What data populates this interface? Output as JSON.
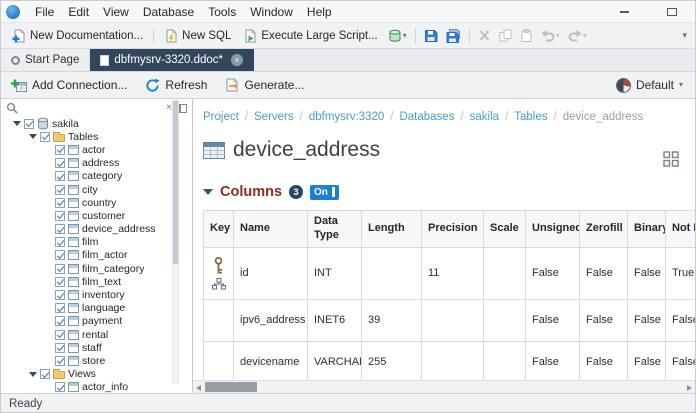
{
  "colors": {
    "accent_blue": "#1b7fd4",
    "link_blue": "#4a9bd5",
    "false_red": "#c13b2a",
    "true_green": "#23984e",
    "section_maroon": "#8e2a1f",
    "active_tab": "#33475c"
  },
  "menu_bar": {
    "items": [
      "File",
      "Edit",
      "View",
      "Database",
      "Tools",
      "Window",
      "Help"
    ]
  },
  "toolbar": {
    "new_documentation": "New Documentation...",
    "new_sql": "New SQL",
    "execute_large_script": "Execute Large Script..."
  },
  "tabs": {
    "start_page": "Start Page",
    "document": "dbfmysrv-3320.ddoc*"
  },
  "doc_toolbar": {
    "add_connection": "Add Connection...",
    "refresh": "Refresh",
    "generate": "Generate...",
    "skin": "Default"
  },
  "tree": {
    "items": [
      {
        "label": "sakila"
      },
      {
        "label": "Tables"
      },
      {
        "label": "actor"
      },
      {
        "label": "address"
      },
      {
        "label": "category"
      },
      {
        "label": "city"
      },
      {
        "label": "country"
      },
      {
        "label": "customer"
      },
      {
        "label": "device_address"
      },
      {
        "label": "film"
      },
      {
        "label": "film_actor"
      },
      {
        "label": "film_category"
      },
      {
        "label": "film_text"
      },
      {
        "label": "inventory"
      },
      {
        "label": "language"
      },
      {
        "label": "payment"
      },
      {
        "label": "rental"
      },
      {
        "label": "staff"
      },
      {
        "label": "store"
      },
      {
        "label": "Views"
      },
      {
        "label": "actor_info"
      }
    ]
  },
  "content": {
    "breadcrumb": {
      "separator": "/",
      "items": [
        "Project",
        "Servers",
        "dbfmysrv:3320",
        "Databases",
        "sakila",
        "Tables",
        "device_address"
      ]
    },
    "title": "device_address",
    "section": {
      "label": "Columns",
      "count": "3",
      "toggle": "On"
    }
  },
  "table": {
    "headers": [
      "Key",
      "Name",
      "Data Type",
      "Length",
      "Precision",
      "Scale",
      "Unsigned",
      "Zerofill",
      "Binary",
      "Not Null"
    ],
    "rows": [
      {
        "key": "primary-key",
        "name": "id",
        "data_type": "INT",
        "length": "",
        "precision": "11",
        "scale": "",
        "unsigned": "False",
        "zerofill": "False",
        "binary": "False",
        "not_null": "True"
      },
      {
        "key": "",
        "name": "ipv6_address",
        "data_type": "INET6",
        "length": "39",
        "precision": "",
        "scale": "",
        "unsigned": "False",
        "zerofill": "False",
        "binary": "False",
        "not_null": "False"
      },
      {
        "key": "",
        "name": "devicename",
        "data_type": "VARCHAR",
        "length": "255",
        "precision": "",
        "scale": "",
        "unsigned": "False",
        "zerofill": "False",
        "binary": "False",
        "not_null": "False"
      }
    ]
  },
  "status_bar": {
    "text": "Ready"
  }
}
